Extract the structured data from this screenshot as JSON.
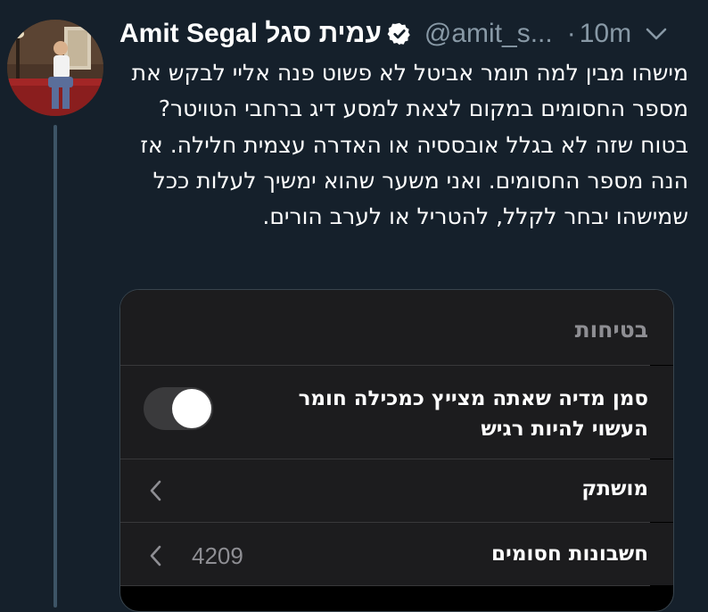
{
  "tweet": {
    "author_name": "Amit Segal עמית סגל",
    "handle": "@amit_s...",
    "separator": "·",
    "time": "10m",
    "text": "מישהו מבין למה תומר אביטל לא פשוט פנה אליי לבקש את מספר החסומים במקום לצאת למסע דיג ברחבי הטויטר? בטוח שזה לא בגלל אובססיה או האדרה עצמית חלילה. אז הנה מספר החסומים. ואני משער שהוא ימשיך לעלות ככל שמישהו יבחר לקלל, להטריל או לערב הורים."
  },
  "embedded_screenshot": {
    "section_title": "בטיחות",
    "sensitive_media_label": "סמן מדיה שאתה מצייץ כמכילה חומר העשוי להיות רגיש",
    "sensitive_media_toggle_on": true,
    "muted_label": "מושתק",
    "blocked_label": "חשבונות חסומים",
    "blocked_count": "4209"
  },
  "colors": {
    "background": "#15202b",
    "secondary_text": "#8899a6",
    "verified_badge": "#ffffff",
    "settings_row": "#1c1c1e"
  }
}
